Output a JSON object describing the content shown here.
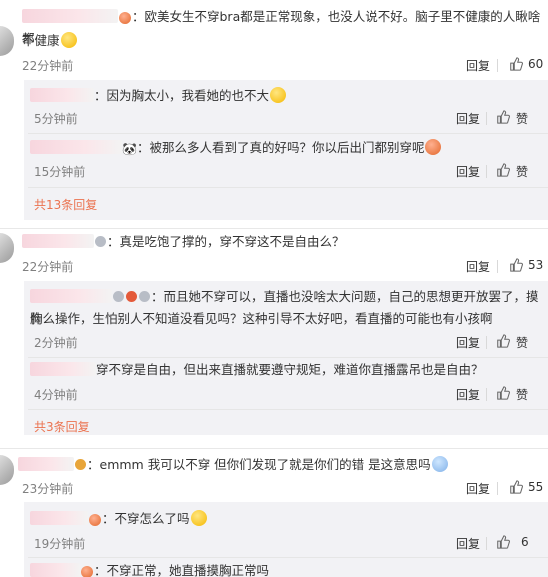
{
  "comments": [
    {
      "text": "：欧美女生不穿bra都是正常现象，也没人说不好。脑子里不健康的人瞅啥都不健康",
      "line1": "：欧美女生不穿bra都是正常现象，也没人说不好。脑子里不健康的人瞅啥都",
      "line2": "不健康",
      "time": "22分钟前",
      "reply_label": "回复",
      "like_count": "60",
      "replies": [
        {
          "text": "：因为胸太小，我看她的也不大",
          "time": "5分钟前",
          "reply_label": "回复",
          "like_label": "赞"
        },
        {
          "text": "：被那么多人看到了真的好吗？你以后出门都别穿呢",
          "time": "15分钟前",
          "reply_label": "回复",
          "like_label": "赞"
        }
      ],
      "more": "共13条回复"
    },
    {
      "text": "：真是吃饱了撑的，穿不穿这不是自由么？",
      "time": "22分钟前",
      "reply_label": "回复",
      "like_count": "53",
      "replies": [
        {
          "line1": "：而且她不穿可以，直播也没啥太大问题，自己的思想更开放罢了，摸胸",
          "line2": "什么操作，生怕别人不知道没看见吗？这种引导不太好吧，看直播的可能也有小孩啊",
          "time": "2分钟前",
          "reply_label": "回复",
          "like_label": "赞"
        },
        {
          "text": "穿不穿是自由，但出来直播就要遵守规矩，难道你直播露吊也是自由？",
          "time": "4分钟前",
          "reply_label": "回复",
          "like_label": "赞"
        }
      ],
      "more": "共3条回复"
    },
    {
      "text": "：emmm 我可以不穿 但你们发现了就是你们的错 是这意思吗",
      "time": "23分钟前",
      "reply_label": "回复",
      "like_count": "55",
      "replies": [
        {
          "text": "：不穿怎么了吗",
          "time": "19分钟前",
          "reply_label": "回复",
          "like_count": "6"
        },
        {
          "text": "：不穿正常，她直播摸胸正常吗"
        }
      ]
    }
  ]
}
